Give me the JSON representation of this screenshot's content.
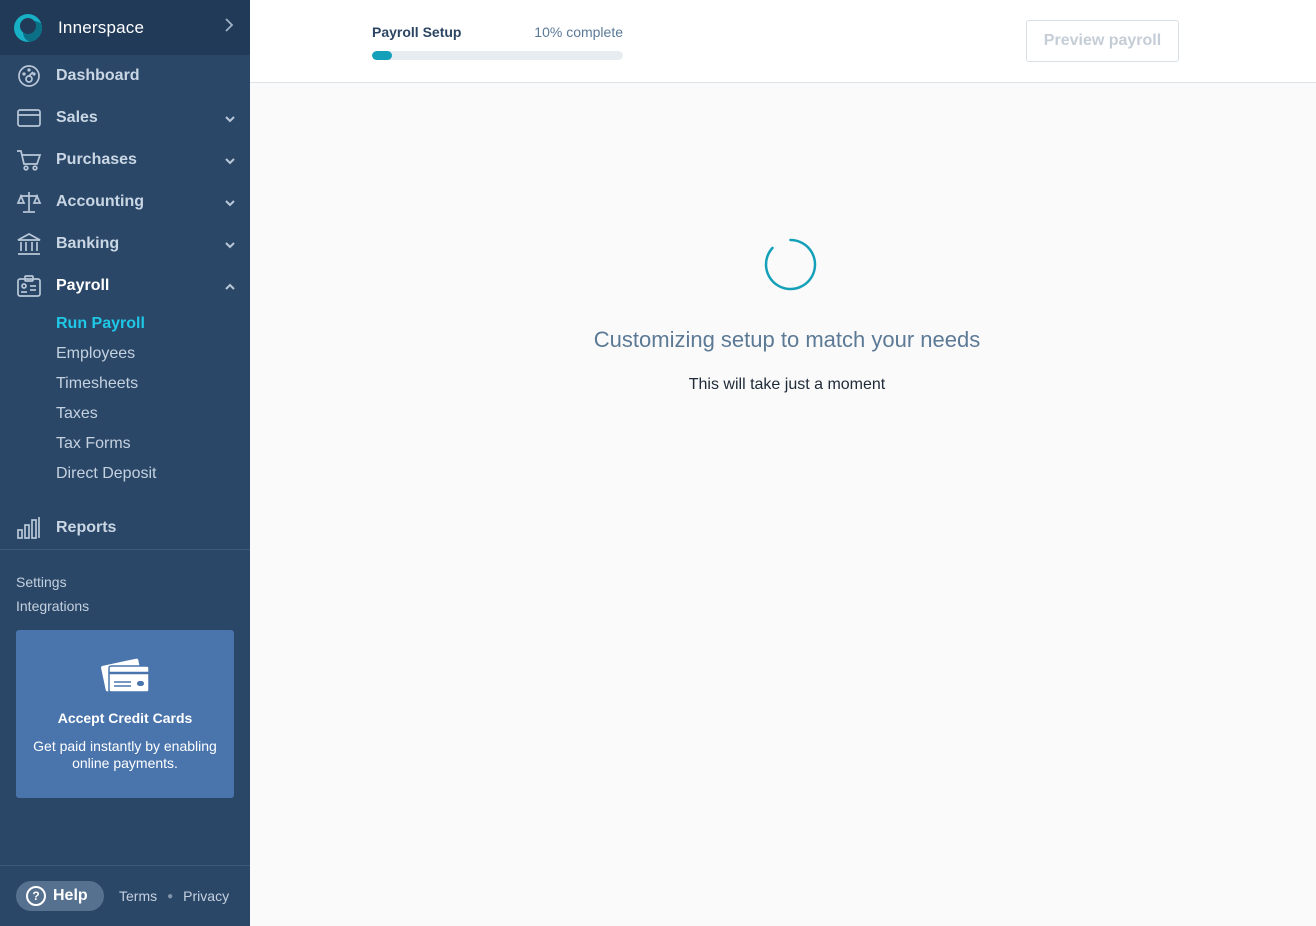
{
  "sidebar": {
    "brand": {
      "name": "Innerspace"
    },
    "nav": [
      {
        "label": "Dashboard",
        "icon": "dashboard-icon"
      },
      {
        "label": "Sales",
        "icon": "sales-card-icon"
      },
      {
        "label": "Purchases",
        "icon": "cart-icon"
      },
      {
        "label": "Accounting",
        "icon": "scales-icon"
      },
      {
        "label": "Banking",
        "icon": "bank-icon"
      },
      {
        "label": "Payroll",
        "icon": "badge-icon"
      }
    ],
    "payroll_sub": [
      {
        "label": "Run Payroll"
      },
      {
        "label": "Employees"
      },
      {
        "label": "Timesheets"
      },
      {
        "label": "Taxes"
      },
      {
        "label": "Tax Forms"
      },
      {
        "label": "Direct Deposit"
      }
    ],
    "reports": {
      "label": "Reports",
      "icon": "bar-chart-icon"
    },
    "settings_label": "Settings",
    "integrations_label": "Integrations",
    "promo": {
      "title": "Accept Credit Cards",
      "text": "Get paid instantly by enabling online payments."
    },
    "footer": {
      "help_label": "Help",
      "terms_label": "Terms",
      "privacy_label": "Privacy"
    }
  },
  "topbar": {
    "progress_title": "Payroll Setup",
    "progress_text": "10% complete",
    "progress_fraction": 0.08,
    "preview_button": "Preview payroll"
  },
  "main": {
    "loading_title": "Customizing setup to match your needs",
    "loading_subtitle": "This will take just a moment"
  },
  "colors": {
    "sidebar_bg": "#2b4768",
    "accent": "#14a0b8",
    "active_link": "#1ec8e6",
    "promo_bg": "#4a74ac"
  }
}
